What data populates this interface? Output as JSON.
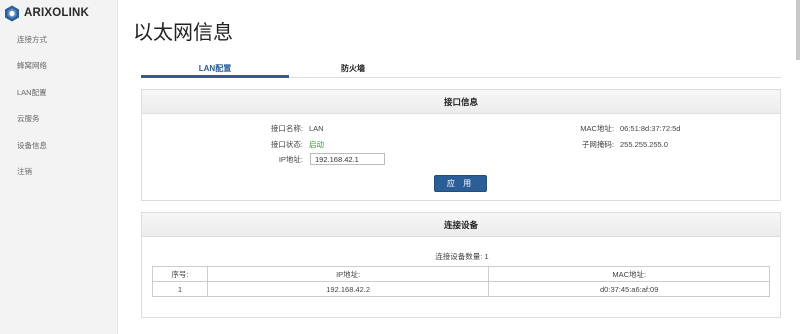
{
  "brand": {
    "name": "ARIXOLINK"
  },
  "sidebar": {
    "items": [
      {
        "label": "连接方式"
      },
      {
        "label": "蜂窝网络"
      },
      {
        "label": "LAN配置"
      },
      {
        "label": "云服务"
      },
      {
        "label": "设备信息"
      },
      {
        "label": "注销"
      }
    ]
  },
  "page": {
    "title": "以太网信息"
  },
  "tabs": [
    {
      "label": "LAN配置",
      "active": true
    },
    {
      "label": "防火墙",
      "active": false
    }
  ],
  "interface": {
    "header": "接口信息",
    "name_label": "接口名称:",
    "name_value": "LAN",
    "status_label": "接口状态:",
    "status_value": "启动",
    "ip_label": "IP地址:",
    "ip_value": "192.168.42.1",
    "mac_label": "MAC地址:",
    "mac_value": "06:51:8d:37:72:5d",
    "mask_label": "子网掩码:",
    "mask_value": "255.255.255.0",
    "apply_label": "应 用"
  },
  "devices": {
    "header": "连接设备",
    "count_label": "连接设备数量:",
    "count_value": "1",
    "columns": [
      "序号:",
      "IP地址:",
      "MAC地址:"
    ],
    "rows": [
      {
        "index": "1",
        "ip": "192.168.42.2",
        "mac": "d0:37:45:a6:af:09"
      }
    ]
  },
  "colors": {
    "accent": "#2b5d97",
    "status_ok": "#2e9b2e",
    "sidebar_bg": "#f3f3f3"
  }
}
